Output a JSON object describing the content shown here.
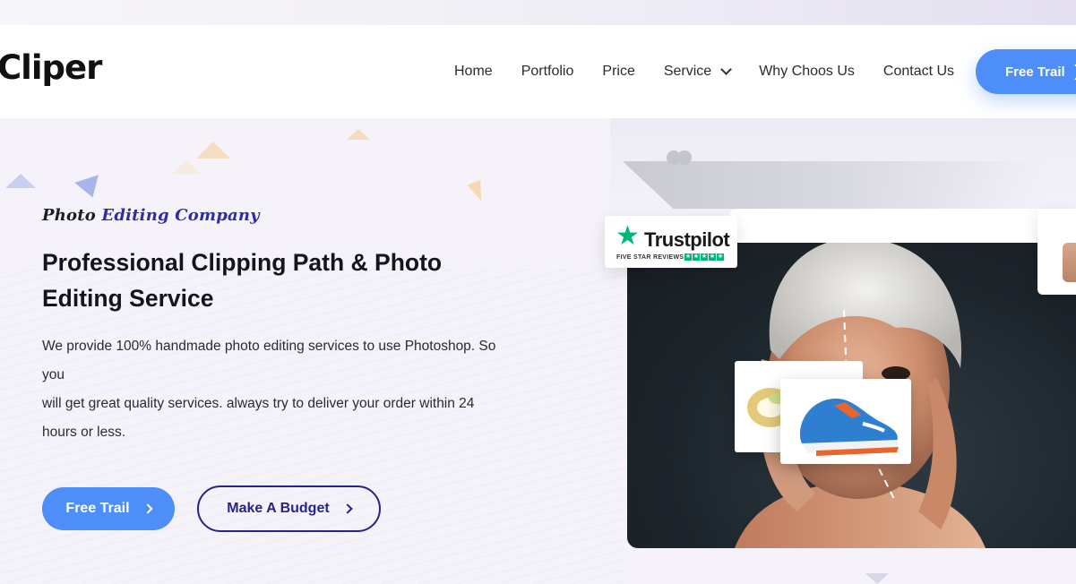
{
  "navbar": {
    "logo": "Cliper",
    "items": [
      {
        "label": "Home"
      },
      {
        "label": "Portfolio"
      },
      {
        "label": "Price"
      },
      {
        "label": "Service"
      },
      {
        "label": "Why Choos Us"
      },
      {
        "label": "Contact Us"
      }
    ],
    "cta_label": "Free Trail"
  },
  "hero": {
    "tagline_part1": "Photo",
    "tagline_part2": "Editing Company",
    "title": "Professional Clipping Path & Photo Editing Service",
    "body_line1": "We provide 100% handmade photo editing services to use Photoshop. So you",
    "body_line2": "will get great quality services. always try to deliver your order within 24 hours or less.",
    "primary_button": "Free Trail",
    "secondary_button": "Make A Budget"
  },
  "trustpilot": {
    "name": "Trustpilot",
    "subtitle": "FIVE STAR REVIEWS"
  },
  "colors": {
    "primary": "#4d8ef8",
    "secondary": "#272389",
    "trustpilot_green": "#00b67a",
    "tagline_accent": "#2d2fa0"
  },
  "icons": [
    "chevron-down-icon",
    "chevron-right-icon",
    "trustpilot-star-icon"
  ]
}
